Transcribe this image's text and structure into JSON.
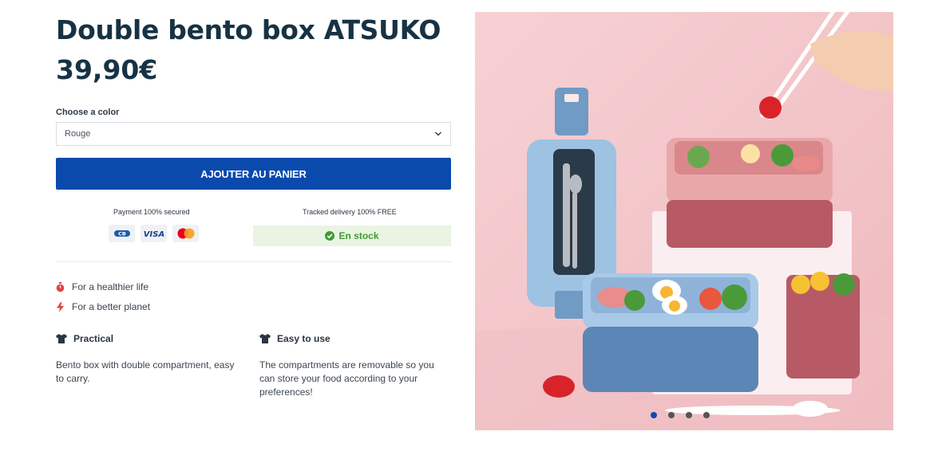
{
  "product": {
    "title": "Double bento box ATSUKO",
    "price": "39,90€"
  },
  "color_select": {
    "label": "Choose a color",
    "value": "Rouge"
  },
  "cta": {
    "label": "AJOUTER AU PANIER"
  },
  "payment": {
    "title": "Payment 100% secured",
    "cards": [
      {
        "icon": "cb-card-icon",
        "text": "CB"
      },
      {
        "icon": "visa-card-icon",
        "text": "VISA"
      },
      {
        "icon": "mastercard-icon",
        "text": ""
      }
    ]
  },
  "delivery": {
    "title": "Tracked delivery 100% FREE",
    "stock_label": "En stock"
  },
  "benefits": [
    {
      "icon": "stopwatch-icon",
      "label": "For a healthier life"
    },
    {
      "icon": "lightning-icon",
      "label": "For a better planet"
    }
  ],
  "features": [
    {
      "icon": "tshirt-icon",
      "title": "Practical",
      "text": "Bento box with double compartment, easy to carry."
    },
    {
      "icon": "tshirt-icon",
      "title": "Easy to use",
      "text": "The compartments are removable so you can store your food according to your preferences!"
    }
  ],
  "gallery": {
    "image_count": 4,
    "active_index": 0
  },
  "colors": {
    "brand_blue": "#0a4aad",
    "title_navy": "#173244",
    "stock_green": "#3f9c35",
    "stock_bg": "#eaf4e3",
    "accent_red": "#e04444"
  }
}
